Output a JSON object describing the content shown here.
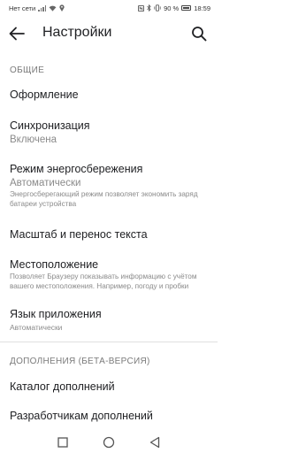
{
  "status_bar": {
    "carrier": "Нет сети",
    "battery": "90 %",
    "time": "18:59",
    "icons": [
      "signal-icon",
      "wifi-icon",
      "location-icon",
      "nfc-icon",
      "bluetooth-icon",
      "vibrate-icon",
      "battery-icon"
    ]
  },
  "appbar": {
    "title": "Настройки",
    "back_icon": "arrow-left-icon",
    "search_icon": "search-icon"
  },
  "sections": {
    "general": "ОБЩИЕ",
    "extensions": "ДОПОЛНЕНИЯ (БЕТА-ВЕРСИЯ)"
  },
  "items": {
    "appearance": {
      "title": "Оформление"
    },
    "sync": {
      "title": "Синхронизация",
      "value": "Включена"
    },
    "power_saving": {
      "title": "Режим энергосбережения",
      "value": "Автоматически",
      "description": "Энергосберегающий режим позволяет экономить заряд батареи устройства"
    },
    "zoom": {
      "title": "Масштаб и перенос текста"
    },
    "location": {
      "title": "Местоположение",
      "description": "Позволяет Браузеру показывать информацию с учётом вашего местоположения. Например, погоду и пробки"
    },
    "language": {
      "title": "Язык приложения",
      "value": "Автоматически"
    },
    "catalog": {
      "title": "Каталог дополнений"
    },
    "developers": {
      "title": "Разработчикам дополнений"
    }
  },
  "navbar": {
    "icons": [
      "recent-apps-icon",
      "home-icon",
      "back-icon"
    ]
  },
  "colors": {
    "text": "#202124",
    "secondary": "#8a8a8a",
    "divider": "#e0e0e0"
  }
}
